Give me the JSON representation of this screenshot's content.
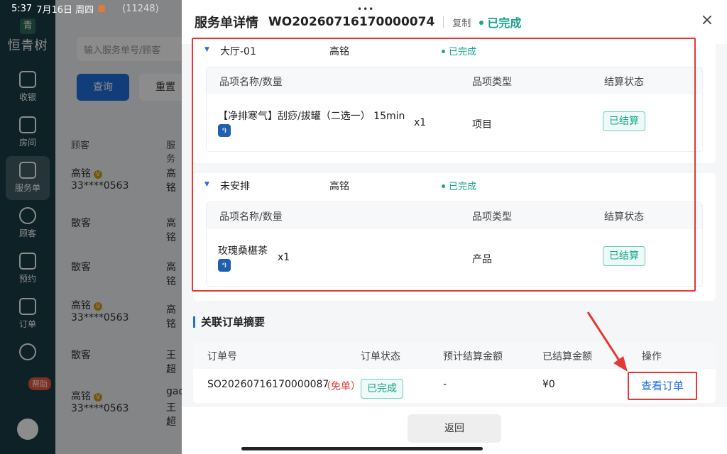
{
  "status_bar": {
    "time": "5:37",
    "date": "7月16日 周四",
    "count": "(11248)"
  },
  "app": {
    "logo_mark": "青",
    "logo_text": "恒青树"
  },
  "nav": [
    {
      "label": "收银"
    },
    {
      "label": "房间"
    },
    {
      "label": "服务单"
    },
    {
      "label": "顾客"
    },
    {
      "label": "预约"
    },
    {
      "label": "订单"
    }
  ],
  "help_label": "帮助",
  "background": {
    "search_placeholder": "输入服务单号/顾客",
    "query_button": "查询",
    "reset_button": "重置",
    "table_headers": [
      "顾客",
      "服务"
    ],
    "rows": [
      {
        "customer": "高铭",
        "vip": "V",
        "phone": "33****0563",
        "staff": "高铭"
      },
      {
        "customer": "散客",
        "vip": "",
        "phone": "",
        "staff": "高铭"
      },
      {
        "customer": "散客",
        "vip": "",
        "phone": "",
        "staff": "高铭"
      },
      {
        "customer": "高铭",
        "vip": "V",
        "phone": "33****0563",
        "staff": "高铭"
      },
      {
        "customer": "散客",
        "vip": "",
        "phone": "",
        "staff": "王超"
      },
      {
        "customer": "高铭",
        "vip": "V",
        "phone": "33****0563",
        "staff": "gao"
      }
    ],
    "row6_staff2": "王超"
  },
  "drawer": {
    "title": "服务单详情",
    "order_no": "WO20260716170000074",
    "copy_label": "复制",
    "status": "已完成",
    "close_icon": "×",
    "groups": [
      {
        "room": "大厅-01",
        "staff": "高铭",
        "status": "已完成",
        "headers": [
          "品项名称/数量",
          "品项类型",
          "结算状态"
        ],
        "item": {
          "name": "【净排寒气】刮痧/拔罐（二选一） 15min",
          "qty": "x1",
          "type": "项目",
          "settle": "已结算"
        }
      },
      {
        "room": "未安排",
        "staff": "高铭",
        "status": "已完成",
        "headers": [
          "品项名称/数量",
          "品项类型",
          "结算状态"
        ],
        "item": {
          "name": "玫瑰桑椹茶",
          "qty": "x1",
          "type": "产品",
          "settle": "已结算"
        }
      }
    ],
    "related_title": "关联订单摘要",
    "order_table": {
      "headers": [
        "订单号",
        "订单状态",
        "预计结算金额",
        "已结算金额",
        "操作"
      ],
      "row": {
        "order_no": "SO20260716170000087",
        "free": "（免单）",
        "status": "已完成",
        "expected": "-",
        "settled": "¥0",
        "action": "查看订单"
      }
    },
    "back_button": "返回"
  },
  "colors": {
    "accent": "#1f6fe0",
    "success": "#19a38d",
    "highlight": "#e53935"
  }
}
